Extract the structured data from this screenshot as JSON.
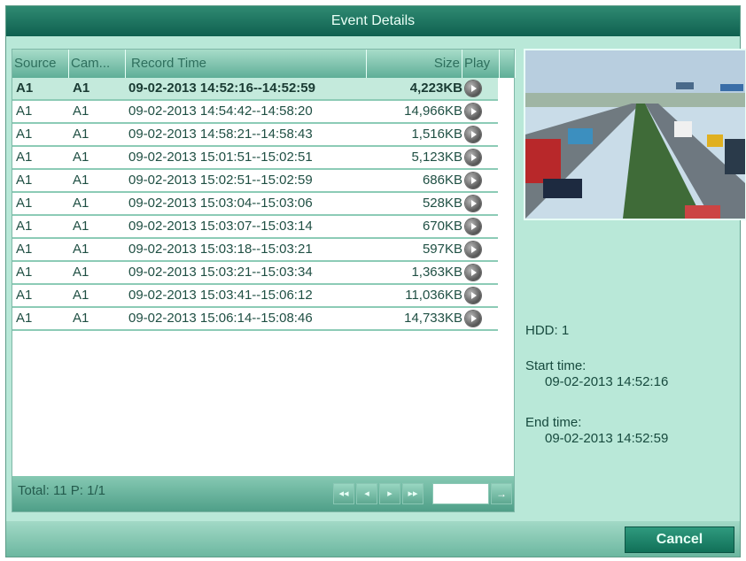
{
  "dialog": {
    "title": "Event Details"
  },
  "table": {
    "columns": {
      "source": "Source",
      "camera": "Cam...",
      "record_time": "Record Time",
      "size": "Size",
      "play": "Play"
    },
    "rows": [
      {
        "source": "A1",
        "camera": "A1",
        "record_time": "09-02-2013 14:52:16--14:52:59",
        "size": "4,223KB",
        "selected": true
      },
      {
        "source": "A1",
        "camera": "A1",
        "record_time": "09-02-2013 14:54:42--14:58:20",
        "size": "14,966KB"
      },
      {
        "source": "A1",
        "camera": "A1",
        "record_time": "09-02-2013 14:58:21--14:58:43",
        "size": "1,516KB"
      },
      {
        "source": "A1",
        "camera": "A1",
        "record_time": "09-02-2013 15:01:51--15:02:51",
        "size": "5,123KB"
      },
      {
        "source": "A1",
        "camera": "A1",
        "record_time": "09-02-2013 15:02:51--15:02:59",
        "size": "686KB"
      },
      {
        "source": "A1",
        "camera": "A1",
        "record_time": "09-02-2013 15:03:04--15:03:06",
        "size": "528KB"
      },
      {
        "source": "A1",
        "camera": "A1",
        "record_time": "09-02-2013 15:03:07--15:03:14",
        "size": "670KB"
      },
      {
        "source": "A1",
        "camera": "A1",
        "record_time": "09-02-2013 15:03:18--15:03:21",
        "size": "597KB"
      },
      {
        "source": "A1",
        "camera": "A1",
        "record_time": "09-02-2013 15:03:21--15:03:34",
        "size": "1,363KB"
      },
      {
        "source": "A1",
        "camera": "A1",
        "record_time": "09-02-2013 15:03:41--15:06:12",
        "size": "11,036KB"
      },
      {
        "source": "A1",
        "camera": "A1",
        "record_time": "09-02-2013 15:06:14--15:08:46",
        "size": "14,733KB"
      }
    ]
  },
  "pagination": {
    "total_label": "Total: 11  P: 1/1",
    "page_input_value": ""
  },
  "details": {
    "hdd": "HDD: 1",
    "start_label": "Start time:",
    "start_value": "09-02-2013 14:52:16",
    "end_label": "End time:",
    "end_value": "09-02-2013 14:52:59"
  },
  "buttons": {
    "cancel": "Cancel"
  },
  "icons": {
    "play": "play-icon",
    "first": "first-page-icon",
    "prev": "prev-page-icon",
    "next": "next-page-icon",
    "last": "last-page-icon",
    "goto": "goto-icon"
  },
  "colors": {
    "accent": "#0f6050",
    "background": "#b9e8d8",
    "selected_row": "#c4eadc"
  }
}
